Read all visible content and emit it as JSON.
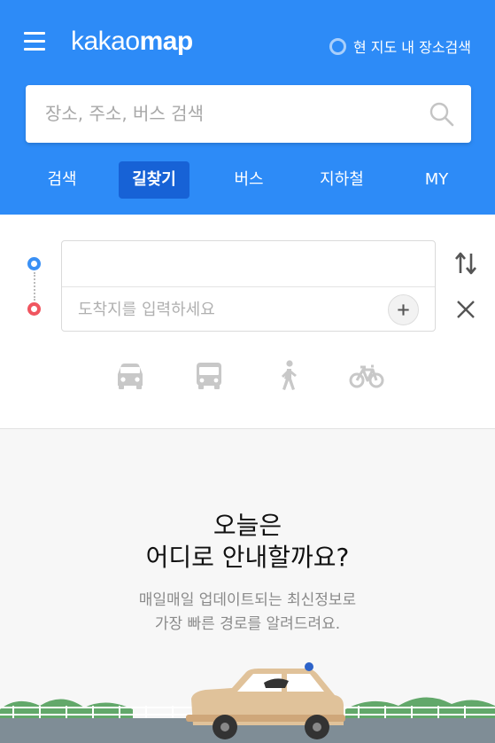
{
  "header": {
    "logo_light": "kakao",
    "logo_bold": "map",
    "map_search_label": "현 지도 내 장소검색",
    "accent_color": "#2d8bf7"
  },
  "search": {
    "placeholder": "장소, 주소, 버스 검색"
  },
  "tabs": [
    {
      "label": "검색"
    },
    {
      "label": "길찾기",
      "active": true
    },
    {
      "label": "버스"
    },
    {
      "label": "지하철"
    },
    {
      "label": "MY"
    }
  ],
  "route": {
    "start_value": "",
    "end_placeholder": "도착지를 입력하세요",
    "modes": [
      "car-icon",
      "bus-icon",
      "walk-icon",
      "bicycle-icon"
    ]
  },
  "empty_state": {
    "title_line1": "오늘은",
    "title_line2": "어디로 안내할까요?",
    "sub_line1": "매일매일 업데이트되는 최신정보로",
    "sub_line2": "가장 빠른 경로를 알려드려요."
  }
}
